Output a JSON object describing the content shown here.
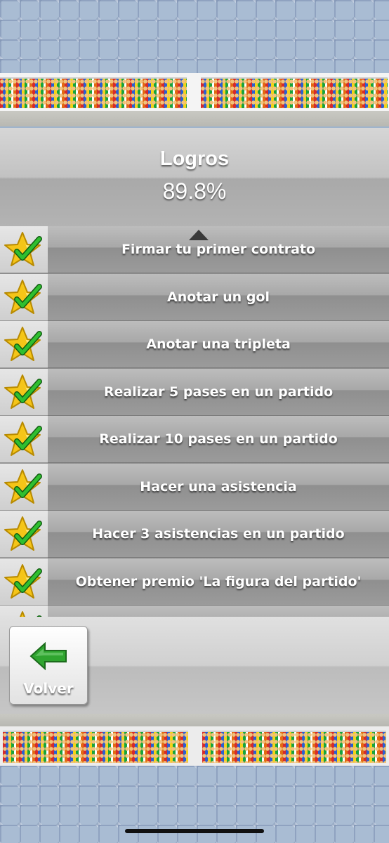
{
  "screen": {
    "title": "Logros",
    "percentage": "89.8%"
  },
  "achievements": [
    {
      "label": "Firmar tu primer contrato",
      "completed": true
    },
    {
      "label": "Anotar un gol",
      "completed": true
    },
    {
      "label": "Anotar una tripleta",
      "completed": true
    },
    {
      "label": "Realizar 5 pases en un partido",
      "completed": true
    },
    {
      "label": "Realizar 10 pases en un partido",
      "completed": true
    },
    {
      "label": "Hacer una asistencia",
      "completed": true
    },
    {
      "label": "Hacer 3 asistencias en un partido",
      "completed": true
    },
    {
      "label": "Obtener premio 'La figura del partido'",
      "completed": true
    },
    {
      "label": "",
      "completed": true
    }
  ],
  "footer": {
    "back_label": "Volver",
    "back_icon": "green-left-arrow-icon"
  },
  "colors": {
    "star": "#f5c518",
    "check": "#23a025",
    "arrow": "#2fa52f"
  }
}
